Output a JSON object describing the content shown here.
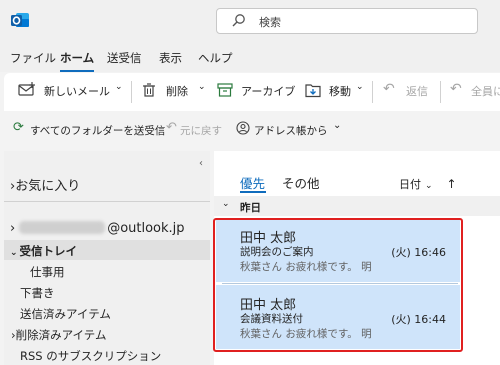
{
  "search": {
    "placeholder": "検索"
  },
  "menu": {
    "file": "ファイル",
    "home": "ホーム",
    "send_receive": "送受信",
    "view": "表示",
    "help": "ヘルプ"
  },
  "ribbon": {
    "new_mail": "新しいメール",
    "delete": "削除",
    "archive": "アーカイブ",
    "move": "移動",
    "reply": "返信",
    "reply_all": "全員に",
    "sync_all": "すべてのフォルダーを送受信",
    "undo": "元に戻す",
    "address_book": "アドレス帳から"
  },
  "folders": {
    "favorites": "お気に入り",
    "account_suffix": "@outlook.jp",
    "inbox": "受信トレイ",
    "work": "仕事用",
    "drafts": "下書き",
    "sent": "送信済みアイテム",
    "deleted": "削除済みアイテム",
    "rss": "RSS のサブスクリプション"
  },
  "list": {
    "tab_focused": "優先",
    "tab_other": "その他",
    "sort": "日付",
    "group": "昨日",
    "messages": [
      {
        "sender": "田中 太郎",
        "subject": "説明会のご案内",
        "preview": "秋葉さん お疲れ様です。 明",
        "time": "(火) 16:46"
      },
      {
        "sender": "田中 太郎",
        "subject": "会議資料送付",
        "preview": "秋葉さん お疲れ様です。 明",
        "time": "(火) 16:44"
      }
    ]
  },
  "colors": {
    "accent": "#0f6cbd",
    "selected": "#cfe4fa",
    "highlight": "#e02020"
  }
}
